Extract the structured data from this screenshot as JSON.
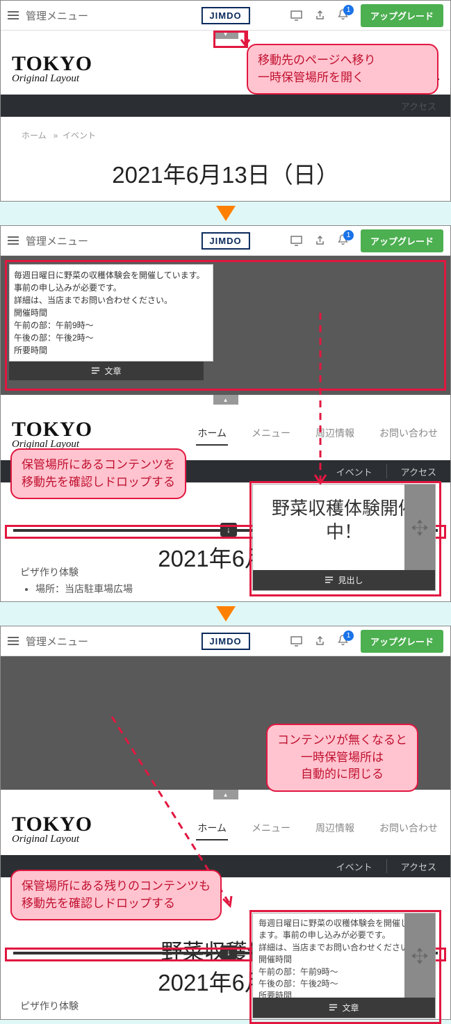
{
  "topbar": {
    "menu_label": "管理メニュー",
    "logo": "JIMDO",
    "badge": "1",
    "upgrade": "アップグレード"
  },
  "site": {
    "logo1": "TOKYO",
    "logo2": "Original Layout"
  },
  "nav": {
    "home": "ホーム",
    "menu": "メニュー",
    "around": "周辺情報",
    "contact": "お問い合わせ"
  },
  "subnav": {
    "event": "イベント",
    "access": "アクセス"
  },
  "crumb": {
    "a": "ホーム",
    "b": "イベント"
  },
  "date_heading": "2021年6月13日（日）",
  "date_short": "2021年6月13",
  "callout1": "移動先のページへ移り\n一時保管場所を開く",
  "callout2": "保管場所にあるコンテンツを\n移動先を確認しドロップする",
  "callout3": "コンテンツが無くなると\n一時保管場所は\n自動的に閉じる",
  "callout4": "保管場所にある残りのコンテンツも\n移動先を確認しドロップする",
  "text_block": {
    "l1": "毎週日曜日に野菜の収穫体験会を開催しています。事前の申し込みが必要です。",
    "l2": "詳細は、当店までお問い合わせください。",
    "l3": "開催時間",
    "l4": "午前の部：午前9時～",
    "l5": "午後の部：午後2時～",
    "l6": "所要時間"
  },
  "block_label_text": "文章",
  "block_label_heading": "見出し",
  "drop_heading": "野菜収穫体験開催中！",
  "drop_heading2": "野菜収穫体験",
  "event_item": {
    "title": "ピザ作り体験",
    "place": "場所：当店駐車場広場"
  }
}
